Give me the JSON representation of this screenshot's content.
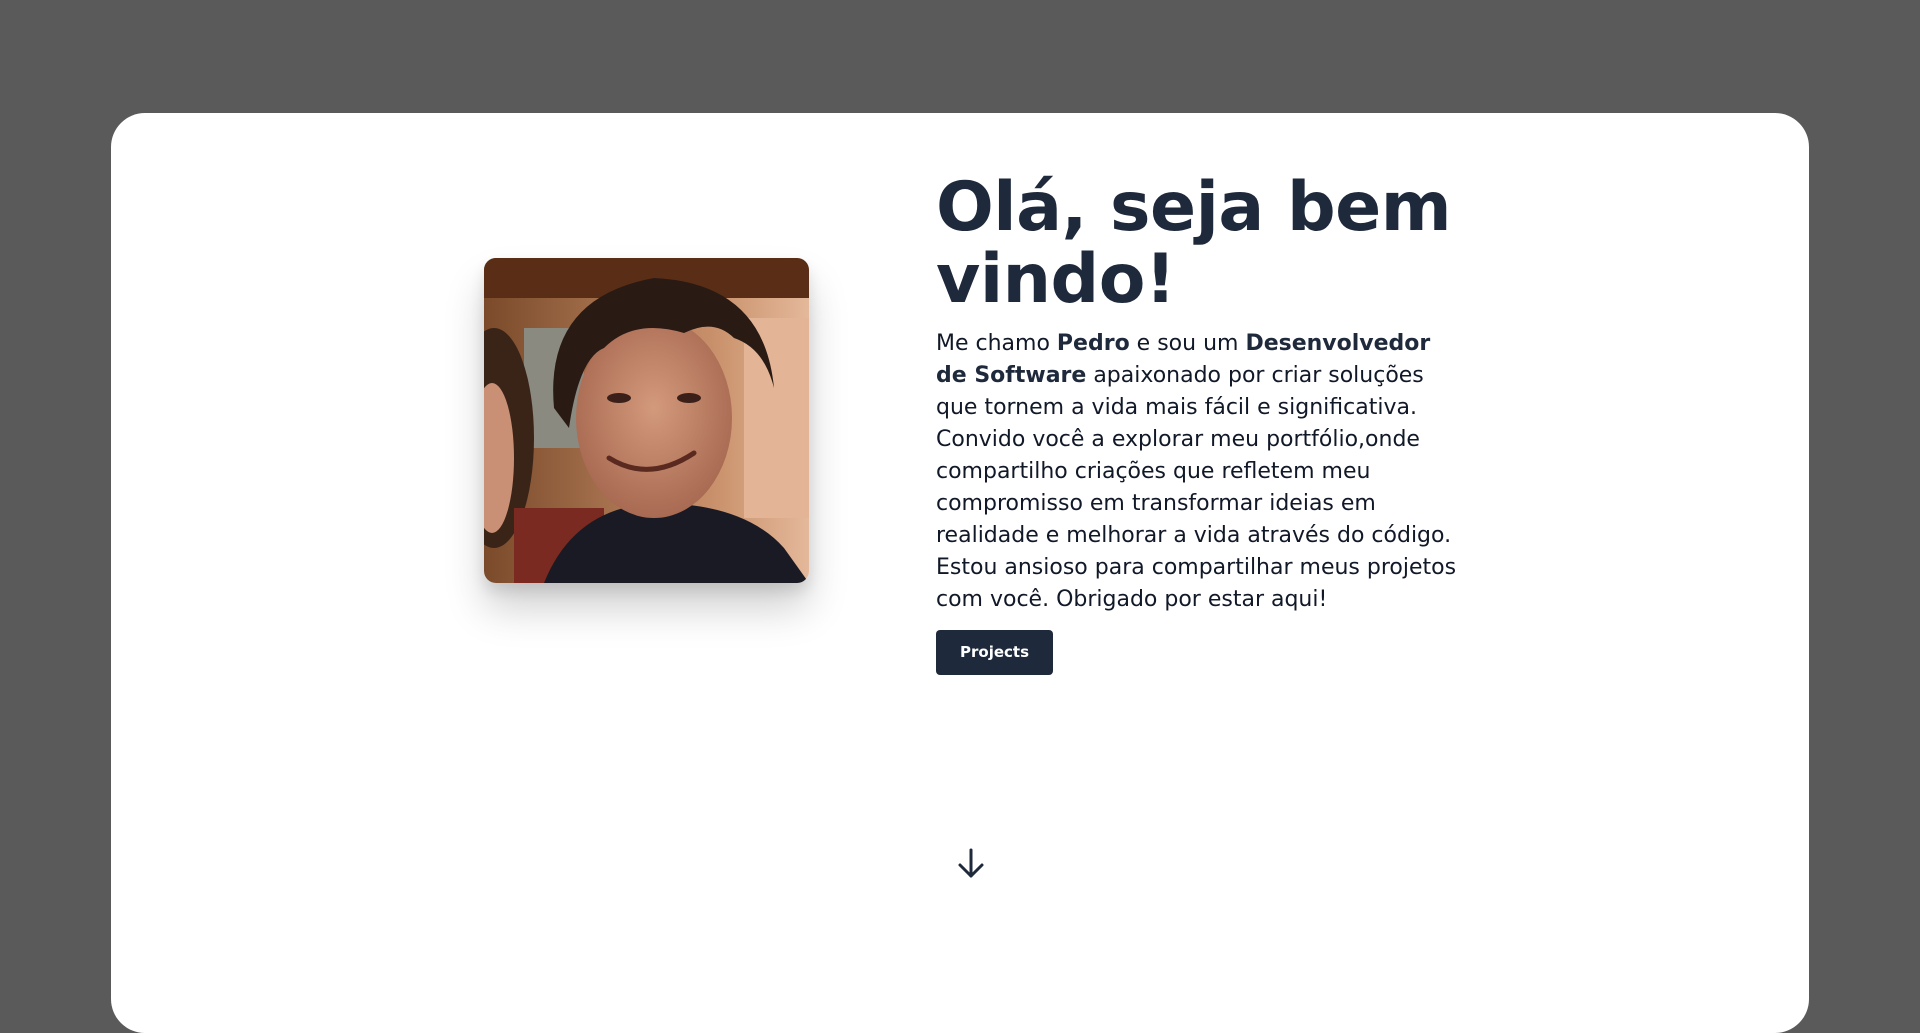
{
  "hero": {
    "title": "Olá, seja bem vindo!",
    "bio": {
      "part1": "Me chamo ",
      "name": "Pedro",
      "part2": " e sou um ",
      "role": "Desenvolvedor de Software",
      "part3": " apaixonado por criar soluções que tornem a vida mais fácil e significativa. Convido você a explorar meu portfólio,onde compartilho criações que refletem meu compromisso em transformar ideias em realidade e melhorar a vida através do código. Estou ansioso para compartilhar meus projetos com você. Obrigado por estar aqui!"
    },
    "button_label": "Projects"
  },
  "icons": {
    "scroll": "arrow-down-icon"
  },
  "colors": {
    "background": "#5a5a5a",
    "card": "#ffffff",
    "text_dark": "#1e293b",
    "button_bg": "#1e293b",
    "button_text": "#ffffff"
  }
}
